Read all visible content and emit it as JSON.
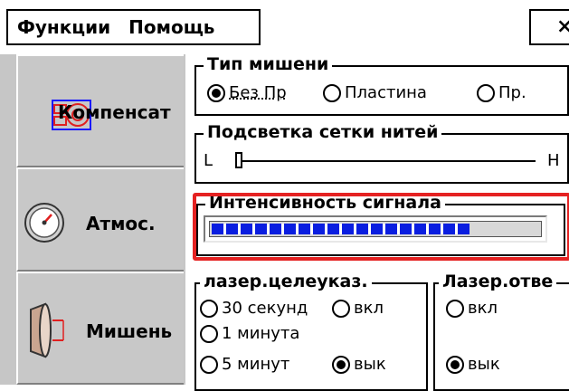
{
  "menu": {
    "functions": "Функции",
    "help": "Помощь",
    "close": "×"
  },
  "sidebar": {
    "items": [
      {
        "label": "Компенсат",
        "icon": "compensation-icon"
      },
      {
        "label": "Атмос.",
        "icon": "gauge-icon"
      },
      {
        "label": "Мишень",
        "icon": "target-lens-icon"
      }
    ]
  },
  "target_type": {
    "title": "Тип мишени",
    "options": [
      {
        "label": "Без Пр",
        "checked": true
      },
      {
        "label": "Пластина",
        "checked": false
      },
      {
        "label": "Пр.",
        "checked": false
      }
    ]
  },
  "reticle": {
    "title": "Подсветка сетки нитей",
    "low": "L",
    "high": "H",
    "level": 0.02
  },
  "signal": {
    "title": "Интенсивность сигнала",
    "level": 0.78
  },
  "laser_pointer": {
    "title": "лазер.целеуказ.",
    "options": [
      {
        "label": "30 секунд"
      },
      {
        "label": "1 минута"
      },
      {
        "label": "5 минут"
      }
    ],
    "on": "вкл",
    "off": "вык"
  },
  "laser_reflect": {
    "title": "Лазер.отве",
    "on": "вкл",
    "off": "вык"
  },
  "colors": {
    "highlight": "#e52222",
    "progress": "#0a1ee0"
  }
}
